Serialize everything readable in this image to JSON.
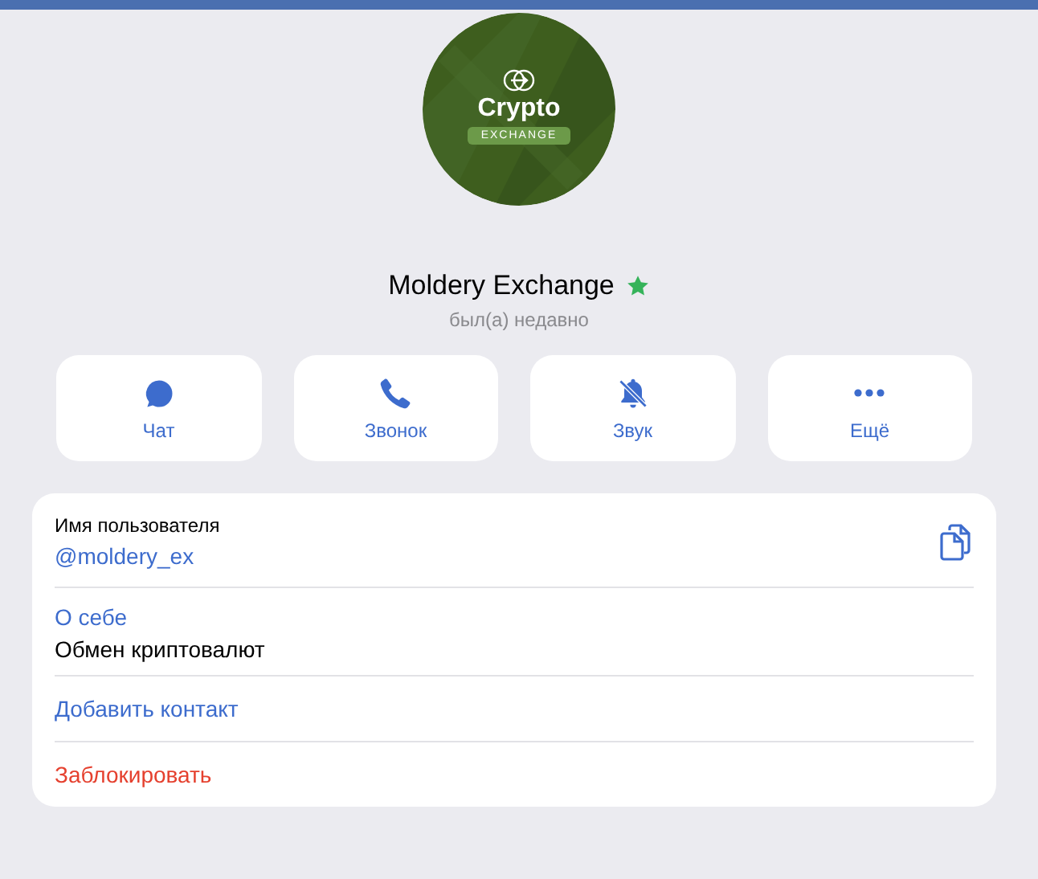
{
  "avatar": {
    "title": "Crypto",
    "subtitle": "EXCHANGE"
  },
  "profile": {
    "name": "Moldery Exchange",
    "verified_star": true,
    "status": "был(а) недавно"
  },
  "actions": [
    {
      "kind": "chat",
      "label": "Чат"
    },
    {
      "kind": "call",
      "label": "Звонок"
    },
    {
      "kind": "mute",
      "label": "Звук"
    },
    {
      "kind": "more",
      "label": "Ещё"
    }
  ],
  "info": {
    "username_label": "Имя пользователя",
    "username": "@moldery_ex",
    "bio_label": "О себе",
    "bio": "Обмен криптовалют"
  },
  "links": [
    {
      "kind": "normal",
      "label": "Добавить контакт"
    },
    {
      "kind": "danger",
      "label": "Заблокировать"
    }
  ]
}
